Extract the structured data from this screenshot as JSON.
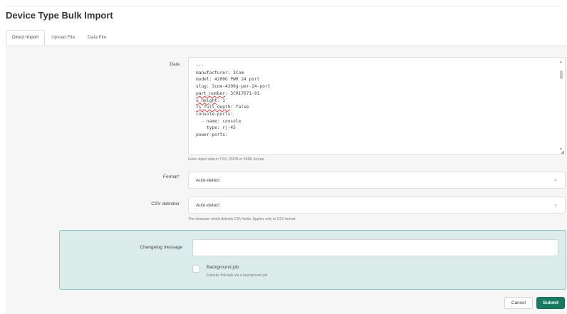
{
  "page": {
    "title": "Device Type Bulk Import"
  },
  "tabs": [
    {
      "label": "Direct Import",
      "active": true
    },
    {
      "label": "Upload File",
      "active": false
    },
    {
      "label": "Data File",
      "active": false
    }
  ],
  "form": {
    "data_label": "Data",
    "data_lines": [
      "---",
      "manufacturer: 3Com",
      "model: 4200G PWR 24 port",
      "slug: 3com-4200g-per-24-port",
      "part_number: 3CR17671-91",
      "u_height: 1",
      "is_full_depth: false",
      "console-ports:",
      "  - name: console",
      "    type: rj-45",
      "power-ports:"
    ],
    "data_help": "Enter object data in CSV, JSON or YAML format.",
    "format_label": "Format",
    "format_required_mark": "*",
    "format_value": "Auto-detect",
    "csv_label": "CSV delimiter",
    "csv_value": "Auto-detect",
    "csv_help": "The character which delimits CSV fields. Applies only to CSV format.",
    "changelog_label": "Changelog message",
    "changelog_value": "",
    "background_job_label": "Background job",
    "background_job_help": "Execute this task via a background job",
    "background_job_checked": false
  },
  "actions": {
    "cancel_label": "Cancel",
    "submit_label": "Submit"
  },
  "colors": {
    "submit": "#1a7a61",
    "changelog_bg": "#dcecea",
    "changelog_border": "#8fc3bd",
    "required": "#d63939"
  },
  "icons": {
    "select_chevron": "chevron-down-icon",
    "resize": "resize-handle-icon"
  }
}
